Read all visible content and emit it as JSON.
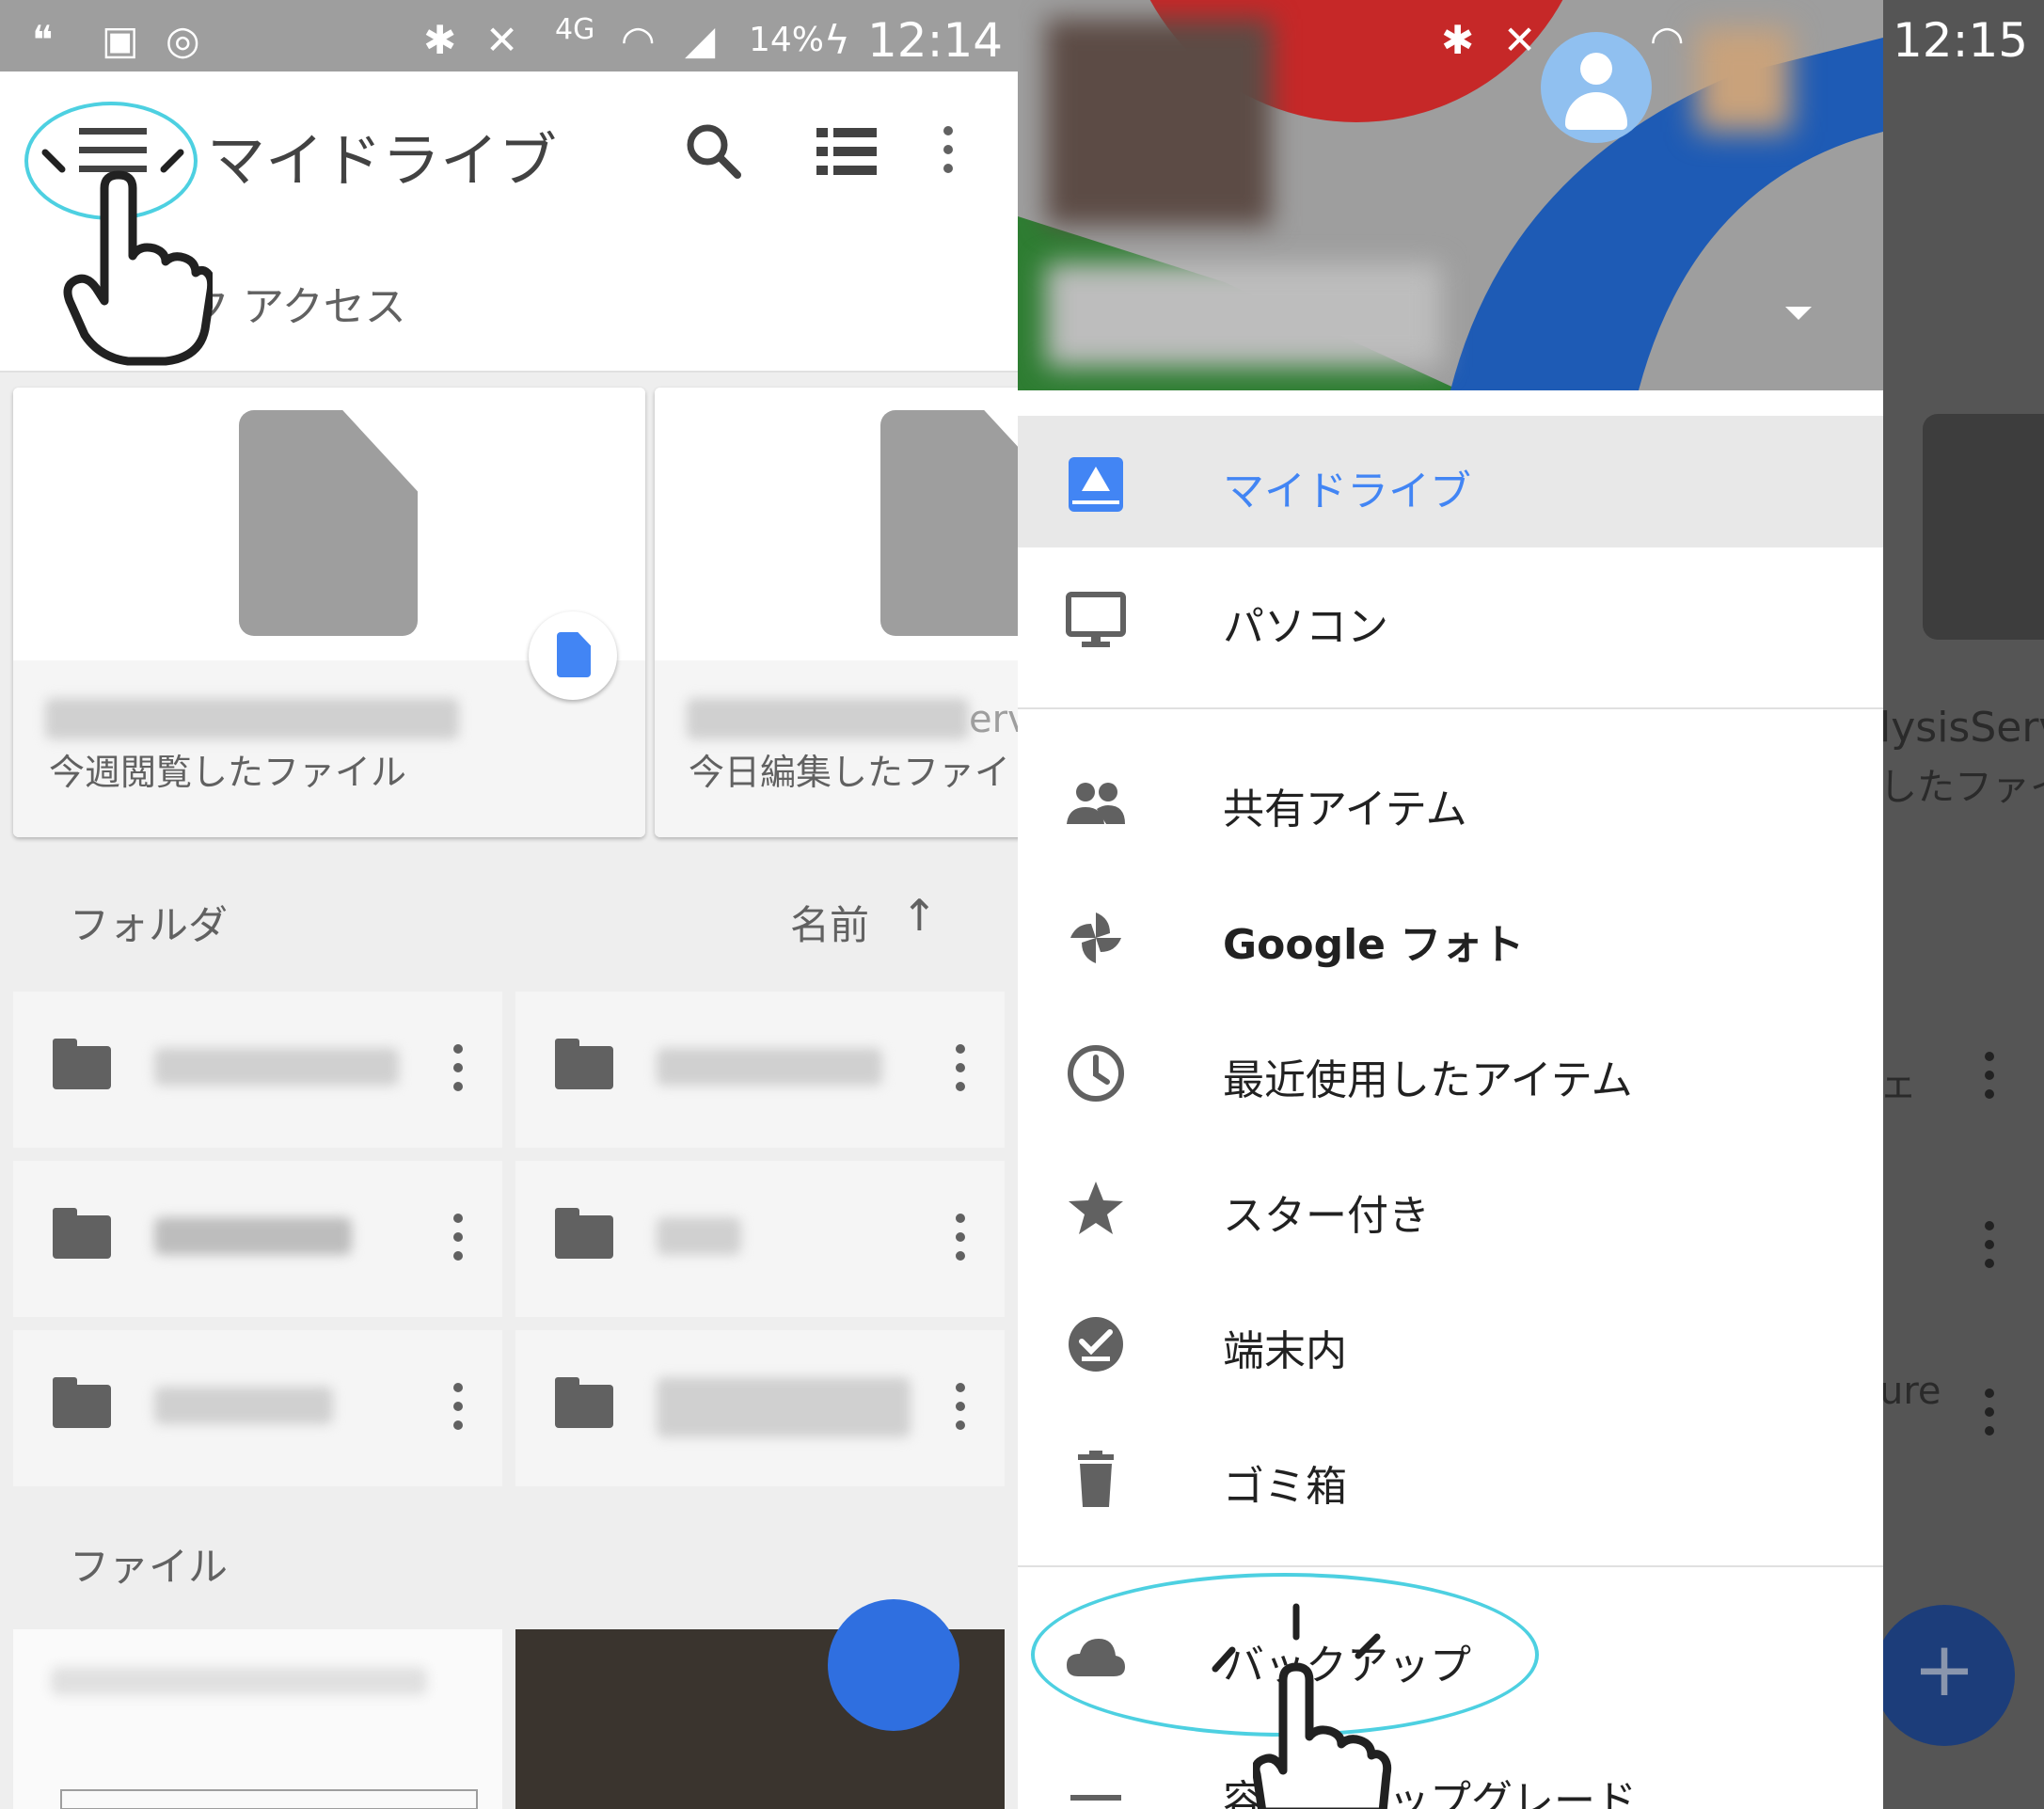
{
  "left": {
    "status": {
      "battery": "14%",
      "time": "12:14"
    },
    "appbar": {
      "title": "マイドライブ"
    },
    "quick_access": {
      "label": "ク アクセス"
    },
    "cards": [
      {
        "caption": "今週閲覧したファイル"
      },
      {
        "caption": "今日編集したファイ",
        "name_fragment": "erv"
      }
    ],
    "folders_header": {
      "label": "フォルダ",
      "sort_label": "名前",
      "sort_arrow": "↑"
    },
    "files_header": {
      "label": "ファイル"
    }
  },
  "right": {
    "status": {
      "time": "12:15"
    },
    "scrim_fragments": [
      "lysisServ",
      "したファイ",
      "ェ",
      "ure"
    ],
    "drawer": {
      "items": [
        {
          "label": "マイドライブ",
          "icon": "drive-icon",
          "selected": true
        },
        {
          "label": "パソコン",
          "icon": "computer-icon"
        },
        {
          "label": "共有アイテム",
          "icon": "people-icon"
        },
        {
          "label": "Google フォト",
          "icon": "pinwheel-icon"
        },
        {
          "label": "最近使用したアイテム",
          "icon": "clock-icon"
        },
        {
          "label": "スター付き",
          "icon": "star-icon"
        },
        {
          "label": "端末内",
          "icon": "offline-check-icon"
        },
        {
          "label": "ゴミ箱",
          "icon": "trash-icon"
        },
        {
          "label": "バックアップ",
          "icon": "cloud-icon"
        },
        {
          "label": "容量をアップグレード",
          "icon": "storage-icon"
        }
      ]
    },
    "fab_symbol": "+"
  },
  "colors": {
    "accent_blue": "#4285f4",
    "highlight_cyan": "#4dd0e1",
    "fab_blue": "#2f6fe0"
  }
}
